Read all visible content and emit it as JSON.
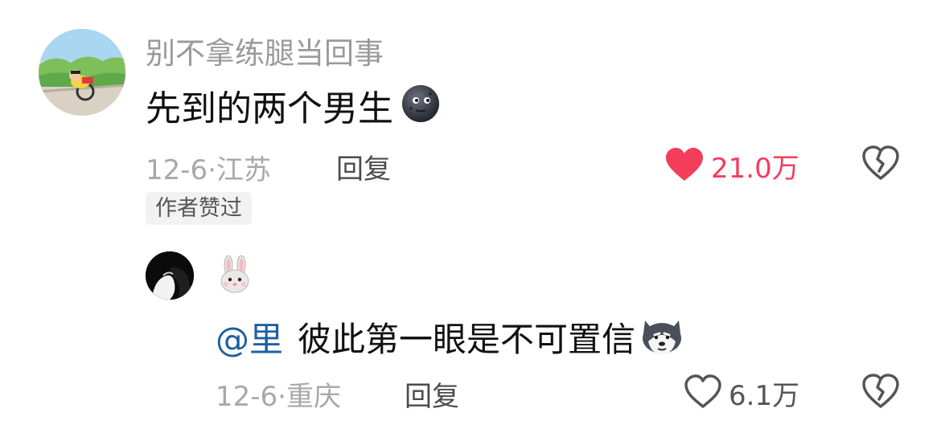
{
  "comment": {
    "username": "别不拿练腿当回事",
    "text": "先到的两个男生",
    "emoji": "moon-face-icon",
    "date": "12-6",
    "separator": "·",
    "location": "江苏",
    "reply_label": "回复",
    "badge": "作者赞过",
    "like_count": "21.0万",
    "like_color": "#f43c5b"
  },
  "reply": {
    "username_emoji": "rabbit-face-icon",
    "mention": "@里",
    "text": "彼此第一眼是不可置信",
    "emoji": "husky-face-icon",
    "date": "12-6",
    "separator": "·",
    "location": "重庆",
    "reply_label": "回复",
    "like_count": "6.1万"
  }
}
